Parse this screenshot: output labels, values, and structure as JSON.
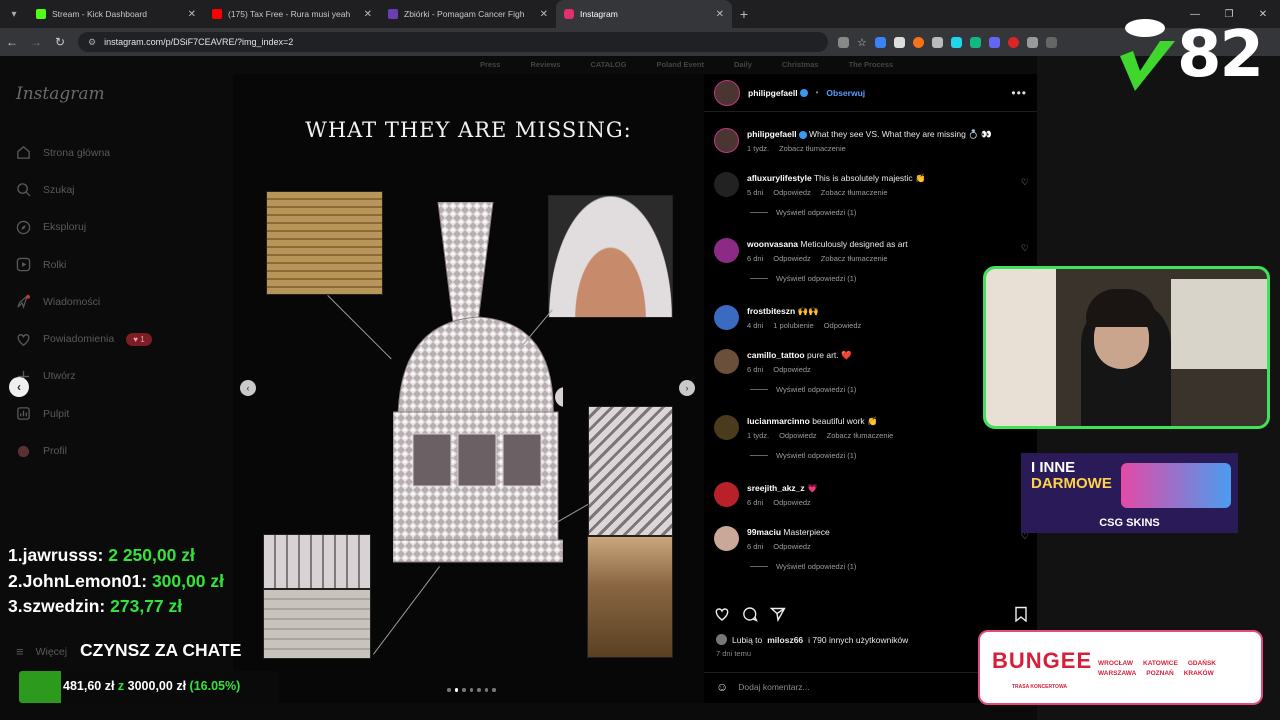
{
  "browser": {
    "tabs": [
      {
        "title": "Stream - Kick Dashboard",
        "color": "#53fc18"
      },
      {
        "title": "(175) Tax Free - Rura musi yeah",
        "color": "#ff0000"
      },
      {
        "title": "Zbiórki - Pomagam Cancer Figh",
        "color": "#6b3fb0"
      },
      {
        "title": "Instagram",
        "color": "#e1306c"
      }
    ],
    "url": "instagram.com/p/DSiF7CEAVRE/?img_index=2"
  },
  "background_nav": [
    "Press",
    "Reviews",
    "CATALOG",
    "Poland Event",
    "Daily",
    "Christmas",
    "The Process"
  ],
  "sidebar": {
    "logo": "Instagram",
    "items": [
      {
        "label": "Strona główna",
        "icon": "home-icon"
      },
      {
        "label": "Szukaj",
        "icon": "search-icon"
      },
      {
        "label": "Eksploruj",
        "icon": "compass-icon"
      },
      {
        "label": "Rolki",
        "icon": "reels-icon"
      },
      {
        "label": "Wiadomości",
        "icon": "messenger-icon"
      },
      {
        "label": "Powiadomienia",
        "icon": "heart-icon"
      },
      {
        "label": "Utwórz",
        "icon": "plus-icon"
      },
      {
        "label": "Pulpit",
        "icon": "dashboard-icon"
      },
      {
        "label": "Profil",
        "icon": "profile-icon"
      }
    ],
    "notif_badge": "1",
    "more_label": "Więcej"
  },
  "post": {
    "heading": "WHAT THEY ARE MISSING:",
    "slide_count": 7,
    "active_slide": 2
  },
  "panel": {
    "author": "philipgefaell",
    "follow": "Obserwuj",
    "caption": {
      "user": "philipgefaell",
      "text": "What they see VS. What they are missing 💍 👀",
      "time": "1 tydz.",
      "translate": "Zobacz tłumaczenie"
    },
    "comments": [
      {
        "user": "afluxurylifestyle",
        "text": "This is absolutely majestic 👏",
        "meta": [
          "5 dni",
          "Odpowiedz",
          "Zobacz tłumaczenie"
        ],
        "replies": "Wyświetl odpowiedzi (1)",
        "color": "#222"
      },
      {
        "user": "woonvasana",
        "text": "Meticulously designed as art",
        "meta": [
          "6 dni",
          "Odpowiedz",
          "Zobacz tłumaczenie"
        ],
        "replies": "Wyświetl odpowiedzi (1)",
        "color": "#8b2b86"
      },
      {
        "user": "frostbiteszn",
        "text": "🙌🙌",
        "meta": [
          "4 dni",
          "1 polubienie",
          "Odpowiedz"
        ],
        "replies": "",
        "color": "#3a6bc1"
      },
      {
        "user": "camillo_tattoo",
        "text": "pure art. ❤️",
        "meta": [
          "6 dni",
          "Odpowiedz"
        ],
        "replies": "Wyświetl odpowiedzi (1)",
        "color": "#6a4f3a"
      },
      {
        "user": "lucianmarcinno",
        "text": "beautiful work 👏",
        "meta": [
          "1 tydz.",
          "Odpowiedz",
          "Zobacz tłumaczenie"
        ],
        "replies": "Wyświetl odpowiedzi (1)",
        "color": "#4a3b1c"
      },
      {
        "user": "sreejith_akz_z",
        "text": "💗",
        "meta": [
          "6 dni",
          "Odpowiedz"
        ],
        "replies": "",
        "color": "#b8202a"
      },
      {
        "user": "99maciu",
        "text": "Masterpiece",
        "meta": [
          "6 dni",
          "Odpowiedz"
        ],
        "replies": "Wyświetl odpowiedzi (1)",
        "color": "#c9a89a"
      }
    ],
    "likes_user": "milosz66",
    "likes_text_pre": "Lubią to",
    "likes_text_post": "i 790 innych użytkowników",
    "date": "7 dni temu",
    "add_comment_placeholder": "Dodaj komentarz..."
  },
  "overlay": {
    "counter": "82",
    "leaderboard": [
      {
        "rank": "1.",
        "name": "jawrusss:",
        "amount": "2 250,00 zł"
      },
      {
        "rank": "2.",
        "name": "JohnLemon01:",
        "amount": "300,00 zł"
      },
      {
        "rank": "3.",
        "name": "szwedzin:",
        "amount": "273,77 zł"
      }
    ],
    "goal_title": "CZYNSZ ZA CHATE",
    "goal_current": "481,60 zł",
    "goal_sep": "z",
    "goal_target": "3000,00 zł",
    "goal_percent_label": "(16.05%)",
    "goal_fraction": 0.1605,
    "csg_top": "I INNE",
    "csg_mid": "DARMOWE",
    "csg_label": "CSG SKINS",
    "bungee_title": "BUNGEE",
    "bungee_sub": "TRASA KONCERTOWA",
    "bungee_cities": [
      "WROCŁAW",
      "KATOWICE",
      "GDAŃSK",
      "WARSZAWA",
      "POZNAŃ",
      "KRAKÓW"
    ]
  }
}
